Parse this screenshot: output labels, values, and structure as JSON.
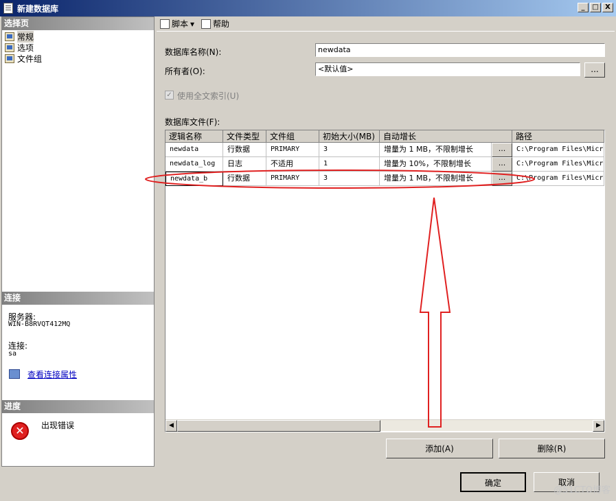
{
  "window": {
    "title": "新建数据库",
    "min": "_",
    "max": "□",
    "close": "X"
  },
  "left": {
    "select_page_header": "选择页",
    "pages": [
      {
        "label": "常规"
      },
      {
        "label": "选项"
      },
      {
        "label": "文件组"
      }
    ],
    "connection_header": "连接",
    "server_label": "服务器:",
    "server_value": "WIN-B8RVQT412MQ",
    "conn_label": "连接:",
    "conn_value": "sa",
    "view_props_link": "查看连接属性",
    "progress_header": "进度",
    "progress_status": "出现错误"
  },
  "toolbar": {
    "script": "脚本",
    "dropdown": "▾",
    "help": "帮助"
  },
  "form": {
    "db_name_label": "数据库名称(N):",
    "db_name_value": "newdata",
    "owner_label": "所有者(O):",
    "owner_value": "<默认值>",
    "browse": "...",
    "fulltext_label": "使用全文索引(U)",
    "files_label": "数据库文件(F):"
  },
  "grid": {
    "columns": [
      "逻辑名称",
      "文件类型",
      "文件组",
      "初始大小(MB)",
      "自动增长",
      "路径"
    ],
    "rows": [
      {
        "name": "newdata",
        "type": "行数据",
        "group": "PRIMARY",
        "size": "3",
        "growth": "增量为 1 MB，不限制增长",
        "path": "C:\\Program Files\\Micr"
      },
      {
        "name": "newdata_log",
        "type": "日志",
        "group": "不适用",
        "size": "1",
        "growth": "增量为 10%，不限制增长",
        "path": "C:\\Program Files\\Micr"
      },
      {
        "name": "newdata_b",
        "type": "行数据",
        "group": "PRIMARY",
        "size": "3",
        "growth": "增量为 1 MB，不限制增长",
        "path": "C:\\Program Files\\Micr"
      }
    ],
    "scroll_left": "◀",
    "scroll_right": "▶"
  },
  "buttons": {
    "add": "添加(A)",
    "remove": "删除(R)",
    "ok": "确定",
    "cancel": "取消"
  },
  "watermark": "@51CTO博客",
  "colors": {
    "annotation": "#e02020",
    "title_start": "#0a246a",
    "title_end": "#a6caf0"
  }
}
